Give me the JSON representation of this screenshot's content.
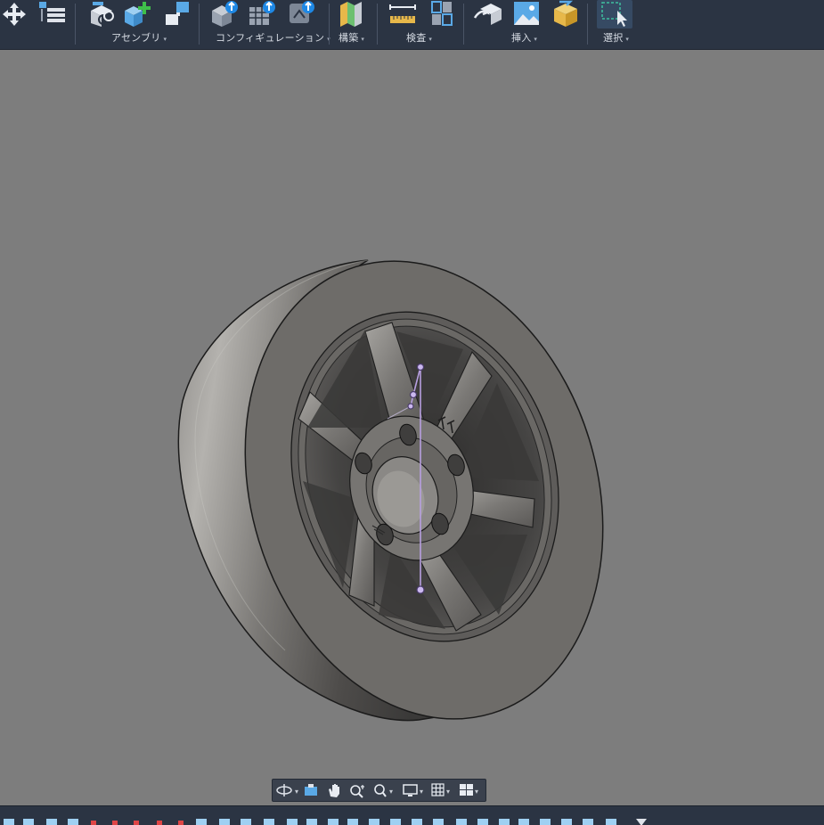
{
  "ribbon": {
    "groups": [
      {
        "id": "assembly",
        "label": "アセンブリ"
      },
      {
        "id": "configuration",
        "label": "コンフィギュレーション"
      },
      {
        "id": "construction",
        "label": "構築"
      },
      {
        "id": "inspect",
        "label": "検査"
      },
      {
        "id": "insert",
        "label": "挿入"
      },
      {
        "id": "select",
        "label": "選択"
      }
    ],
    "caret": "▾"
  },
  "navbar": {
    "caret": "▾",
    "tools": [
      "orbit-icon",
      "look-at-icon",
      "pan-icon",
      "zoom-icon",
      "fit-icon",
      "display-settings-icon",
      "grid-icon",
      "viewports-icon"
    ]
  },
  "colors": {
    "ribbon_bg": "#2b3443",
    "viewport_bg": "#7d7d7d",
    "model_face": "#6e6c69",
    "sketch_line": "#b79fe0"
  }
}
